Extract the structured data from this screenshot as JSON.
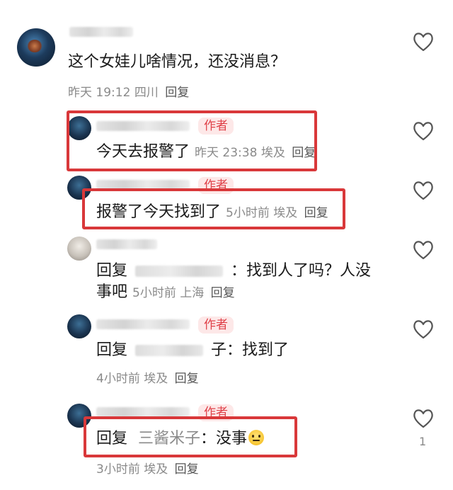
{
  "comments": [
    {
      "text": "这个女娃儿啥情况，还没消息？",
      "time": "昨天 19:12",
      "location": "四川",
      "reply_label": "回复"
    },
    {
      "author_tag": "作者",
      "text": "今天去报警了",
      "time": "昨天 23:38",
      "location": "埃及",
      "reply_label": "回复"
    },
    {
      "author_tag": "作者",
      "text": "报警了今天找到了",
      "time": "5小时前",
      "location": "埃及",
      "reply_label": "回复"
    },
    {
      "reply_prefix": "回复",
      "text_suffix": "：找到人了吗？人没",
      "text_line2": "事吧",
      "time": "5小时前",
      "location": "上海",
      "reply_label": "回复"
    },
    {
      "author_tag": "作者",
      "reply_prefix": "回复",
      "text_suffix": "子：找到了",
      "time": "4小时前",
      "location": "埃及",
      "reply_label": "回复"
    },
    {
      "author_tag": "作者",
      "reply_prefix": "回复",
      "reply_target": "三酱米子",
      "text_suffix": "：没事",
      "time": "3小时前",
      "location": "埃及",
      "reply_label": "回复",
      "like_count": "1"
    }
  ]
}
